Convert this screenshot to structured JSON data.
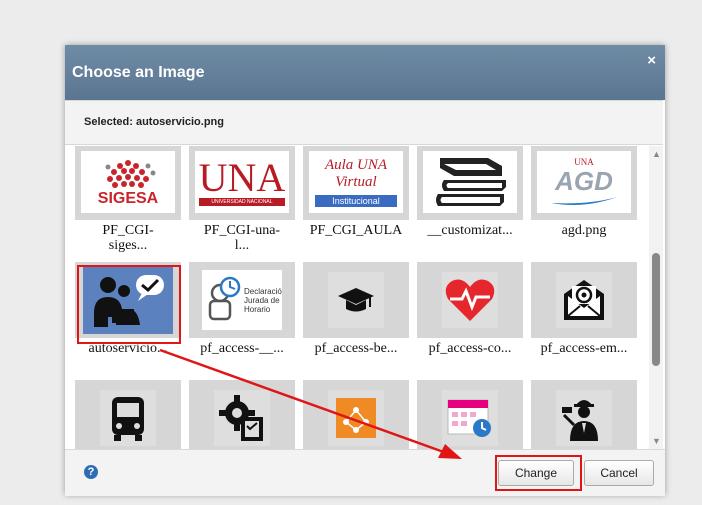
{
  "dialog": {
    "title": "Choose an Image",
    "close_label": "×",
    "selected_label": "Selected: autoservicio.png",
    "help_label": "?",
    "change_label": "Change",
    "cancel_label": "Cancel"
  },
  "tiles": [
    {
      "caption": "PF_CGI-\nsiges...",
      "thumb_text": "SIGESA"
    },
    {
      "caption": "PF_CGI-una-\nl...",
      "thumb_text": "UNA",
      "thumb_subtext": "UNIVERSIDAD NACIONAL"
    },
    {
      "caption": "PF_CGI_AULA",
      "thumb_text": "Aula UNA Virtual",
      "thumb_subtext": "Institucional"
    },
    {
      "caption": "__customizat...",
      "thumb_text": ""
    },
    {
      "caption": "agd.png",
      "thumb_text": "AGD",
      "thumb_subtext": "UNA"
    },
    {
      "caption": "autoservicio...",
      "thumb_text": ""
    },
    {
      "caption": "pf_access-__...",
      "thumb_text": "Declaración Jurada de Horario"
    },
    {
      "caption": "pf_access-be...",
      "thumb_text": ""
    },
    {
      "caption": "pf_access-co...",
      "thumb_text": ""
    },
    {
      "caption": "pf_access-em...",
      "thumb_text": ""
    },
    {
      "caption": "",
      "thumb_text": ""
    },
    {
      "caption": "",
      "thumb_text": ""
    },
    {
      "caption": "",
      "thumb_text": ""
    },
    {
      "caption": "",
      "thumb_text": ""
    },
    {
      "caption": "",
      "thumb_text": ""
    }
  ],
  "colors": {
    "highlight": "#e01515",
    "titlebar": "#5f7b95"
  }
}
